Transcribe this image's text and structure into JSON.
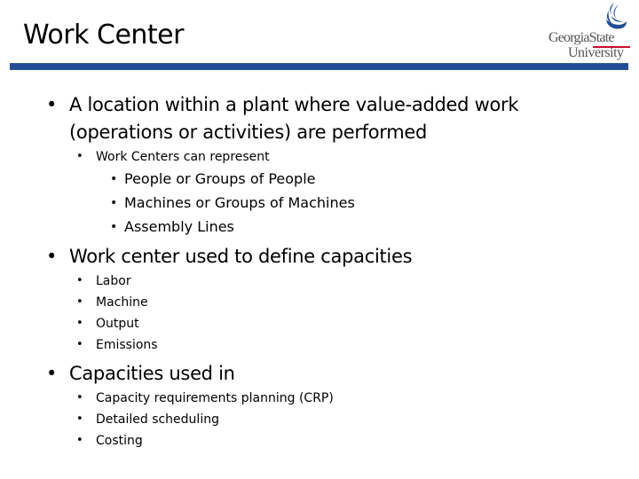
{
  "header": {
    "title": "Work Center",
    "logo": {
      "icon": "flame-icon",
      "line1": "GeorgiaState",
      "line2": "University",
      "brand_blue": "#1f4e96",
      "accent_red": "#c8102e"
    }
  },
  "bullet_glyph": "•",
  "sections": [
    {
      "text_line1": "A location within a plant where value-added work",
      "text_line2": "(operations or activities) are performed",
      "sub": {
        "text": "Work Centers can represent",
        "items": [
          "People or Groups of People",
          "Machines or Groups of Machines",
          "Assembly Lines"
        ]
      }
    },
    {
      "text": "Work center used to define capacities",
      "items": [
        "Labor",
        "Machine",
        "Output",
        "Emissions"
      ]
    },
    {
      "text": "Capacities used in",
      "items": [
        "Capacity requirements planning (CRP)",
        "Detailed scheduling",
        "Costing"
      ]
    }
  ]
}
